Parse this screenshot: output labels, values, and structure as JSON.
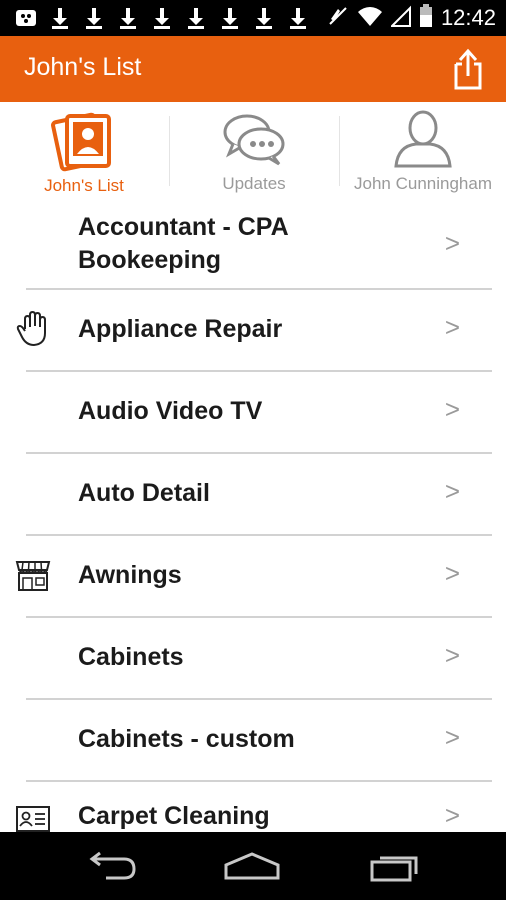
{
  "status_bar": {
    "notifications": [
      "download-icon",
      "download-icon",
      "download-icon",
      "download-icon",
      "download-icon",
      "download-icon",
      "download-icon",
      "download-icon"
    ],
    "time": "12:42"
  },
  "app_bar": {
    "title": "John's List"
  },
  "tabs": [
    {
      "label": "John's List",
      "icon": "photo-stack-icon",
      "active": true
    },
    {
      "label": "Updates",
      "icon": "chat-bubbles-icon",
      "active": false
    },
    {
      "label": "John Cunningham",
      "icon": "person-icon",
      "active": false
    }
  ],
  "list": {
    "items": [
      {
        "label_line1": "Accountant - CPA",
        "label_line2": "Bookeeping",
        "icon": "",
        "chevron": ">"
      },
      {
        "label": "Appliance Repair",
        "icon": "hand-icon",
        "chevron": ">"
      },
      {
        "label": "Audio Video TV",
        "icon": "",
        "chevron": ">"
      },
      {
        "label": "Auto Detail",
        "icon": "",
        "chevron": ">"
      },
      {
        "label": "Awnings",
        "icon": "storefront-icon",
        "chevron": ">"
      },
      {
        "label": "Cabinets",
        "icon": "",
        "chevron": ">"
      },
      {
        "label": "Cabinets - custom",
        "icon": "",
        "chevron": ">"
      },
      {
        "label": "Carpet Cleaning",
        "icon": "id-card-icon",
        "chevron": ">"
      }
    ]
  },
  "colors": {
    "accent": "#e8600f",
    "text": "#1b1b1b",
    "muted": "#9a9a9a"
  }
}
